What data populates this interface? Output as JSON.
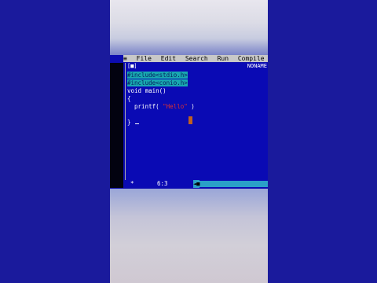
{
  "menu": {
    "system": "≡",
    "items": [
      "File",
      "Edit",
      "Search",
      "Run",
      "Compile"
    ]
  },
  "window": {
    "close_button": "[■]",
    "name": "NONAME"
  },
  "code": {
    "line1": "#include<stdio.h>",
    "line2": "#include<conio.h>",
    "line3": "void main()",
    "line4": "{",
    "line5_prefix": "  printf( ",
    "line5_string": "\"Hello\"",
    "line5_suffix": " )",
    "line7": "}"
  },
  "status": {
    "star": "*",
    "position": "6:3",
    "arrow": "◄■"
  },
  "colors": {
    "background": "#0a0ab4",
    "menubar": "#c8c8c8",
    "highlight": "#18a8b0"
  }
}
